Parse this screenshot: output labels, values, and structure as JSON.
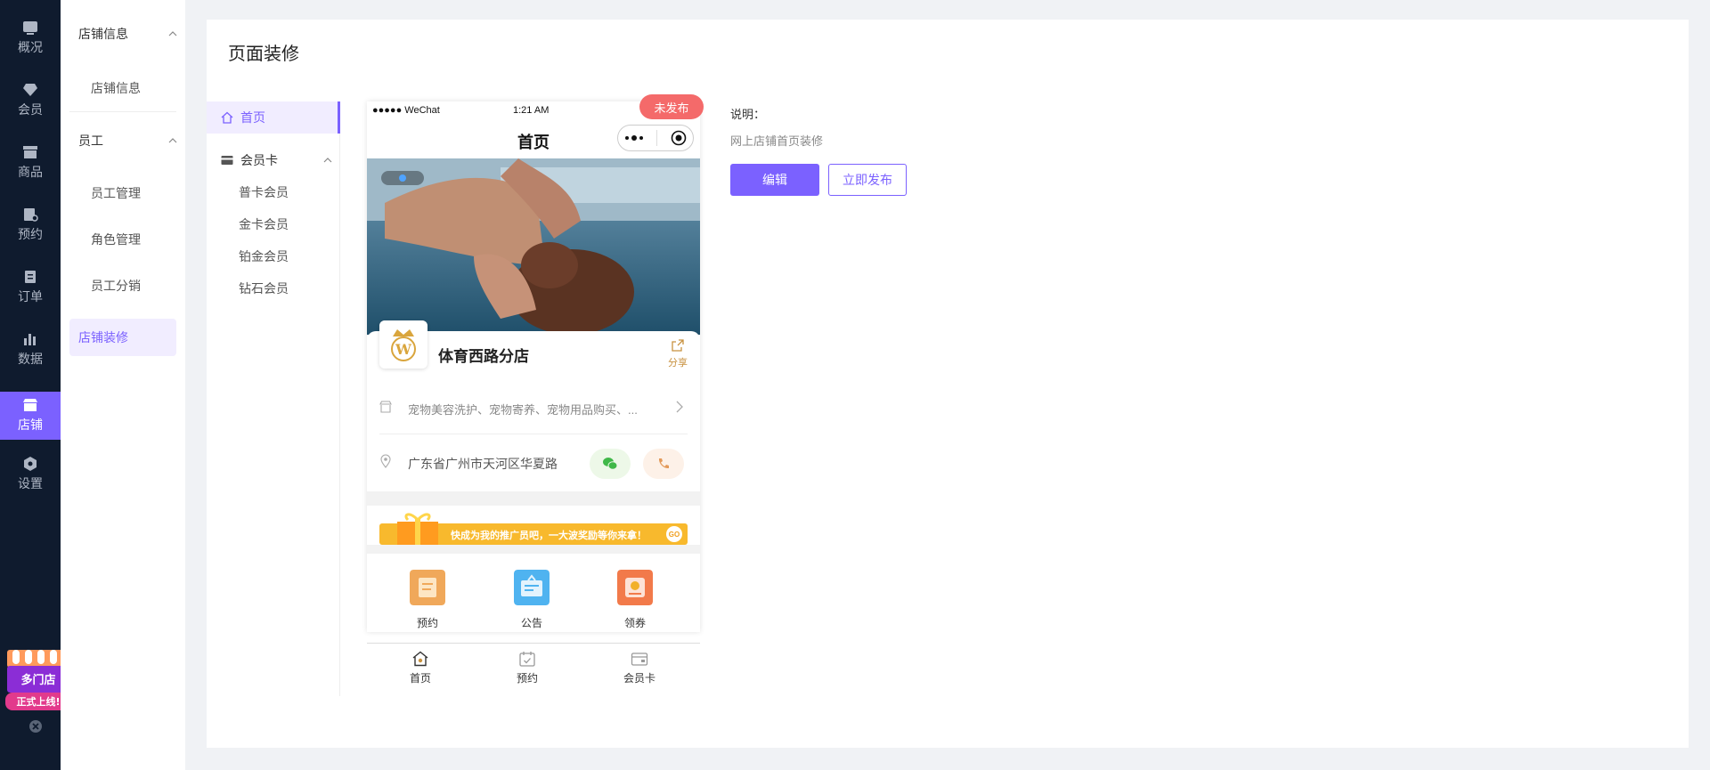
{
  "rail": {
    "items": [
      {
        "label": "概况",
        "icon": "dashboard-icon"
      },
      {
        "label": "会员",
        "icon": "diamond-icon"
      },
      {
        "label": "商品",
        "icon": "product-icon"
      },
      {
        "label": "预约",
        "icon": "booking-icon"
      },
      {
        "label": "订单",
        "icon": "order-icon"
      },
      {
        "label": "数据",
        "icon": "data-chart-icon"
      },
      {
        "label": "店铺",
        "icon": "store-icon"
      },
      {
        "label": "设置",
        "icon": "settings-icon"
      }
    ],
    "active": "店铺",
    "promo": {
      "line1": "多门店",
      "line2": "正式上线!"
    }
  },
  "subnav": {
    "groups": [
      {
        "label": "店铺信息",
        "items": [
          "店铺信息"
        ]
      },
      {
        "label": "员工",
        "items": [
          "员工管理",
          "角色管理",
          "员工分销"
        ]
      }
    ],
    "active_item": "店铺装修"
  },
  "main": {
    "title": "页面装修",
    "tree": {
      "home": "首页",
      "group": "会员卡",
      "sub_items": [
        "普卡会员",
        "金卡会员",
        "铂金会员",
        "钻石会员"
      ]
    },
    "status_badge": "未发布",
    "phone": {
      "status_left": "●●●●● WeChat",
      "status_time": "1:21 AM",
      "nav_title": "首页",
      "store_name": "体育西路分店",
      "share_label": "分享",
      "services": "宠物美容洗护、宠物寄养、宠物用品购买、...",
      "address": "广东省广州市天河区华夏路",
      "promo_text": "快成为我的推广员吧，一大波奖励等你来拿！",
      "promo_go": "GO",
      "quick_links": [
        {
          "label": "预约",
          "color": "#f0a85a"
        },
        {
          "label": "公告",
          "color": "#4fb3f0"
        },
        {
          "label": "领券",
          "color": "#f27a4a"
        }
      ],
      "tabs": [
        "首页",
        "预约",
        "会员卡"
      ]
    },
    "description": {
      "label": "说明：",
      "text": "网上店铺首页装修"
    },
    "buttons": {
      "edit": "编辑",
      "publish": "立即发布"
    }
  },
  "colors": {
    "accent": "#7b61ff",
    "rail_bg": "#0f1b2e",
    "badge": "#f46a6a",
    "share": "#c8913f"
  }
}
